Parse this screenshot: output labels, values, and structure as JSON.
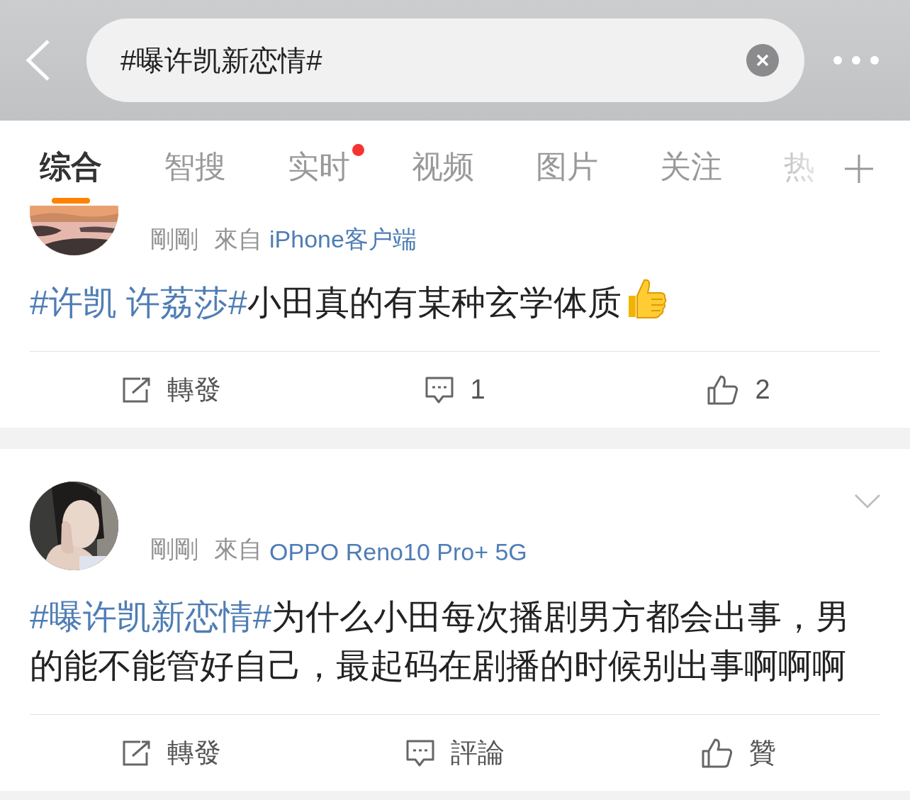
{
  "search": {
    "value": "#曝许凯新恋情#"
  },
  "tabs": [
    {
      "label": "综合",
      "selected": true,
      "dot": false
    },
    {
      "label": "智搜",
      "selected": false,
      "dot": false
    },
    {
      "label": "实时",
      "selected": false,
      "dot": true
    },
    {
      "label": "视频",
      "selected": false,
      "dot": false
    },
    {
      "label": "图片",
      "selected": false,
      "dot": false
    },
    {
      "label": "关注",
      "selected": false,
      "dot": false
    },
    {
      "label": "热",
      "selected": false,
      "dot": false
    }
  ],
  "posts": [
    {
      "kind": "clipped",
      "time": "剛剛",
      "source_prefix": "來自",
      "source": "iPhone客户端",
      "menu": false,
      "hashtag": "#许凯 许荔莎#",
      "text": "小田真的有某种玄学体质",
      "thumbs_emoji": true,
      "repost": "轉發",
      "comment": "1",
      "like": "2"
    },
    {
      "kind": "full",
      "time": "剛剛",
      "source_prefix": "來自",
      "source": "OPPO Reno10 Pro+ 5G",
      "menu": true,
      "hashtag": "#曝许凯新恋情#",
      "text": "为什么小田每次播剧男方都会出事，男的能不能管好自己，最起码在剧播的时候别出事啊啊啊",
      "thumbs_emoji": false,
      "repost": "轉發",
      "comment": "評論",
      "like": "贊"
    }
  ]
}
